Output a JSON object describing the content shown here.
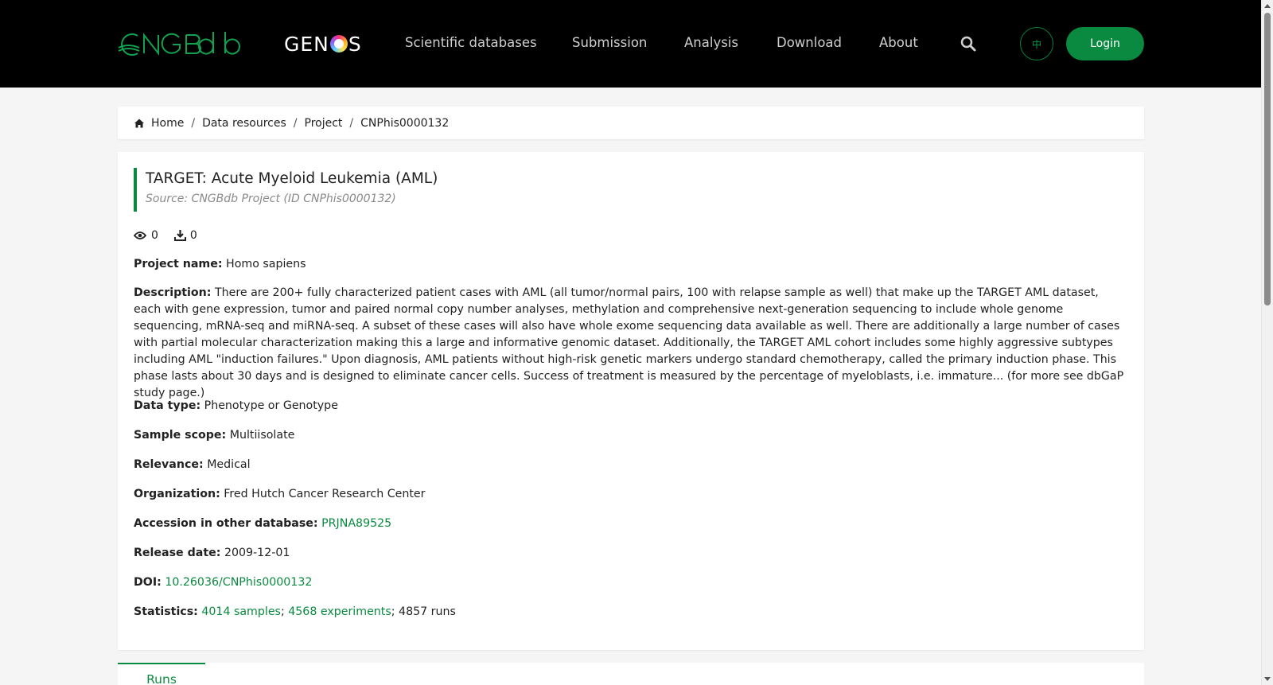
{
  "header": {
    "logo_cngb": "CNGBdb",
    "logo_genos_pre": "GEN",
    "logo_genos_post": "S",
    "nav": [
      "Scientific databases",
      "Submission",
      "Analysis",
      "Download",
      "About"
    ],
    "search_icon": "search-icon",
    "lang_label": "中",
    "login_label": "Login",
    "accent_color": "#0a8a40"
  },
  "breadcrumb": {
    "home_icon": "home-icon",
    "items": [
      "Home",
      "Data resources",
      "Project",
      "CNPhis0000132"
    ]
  },
  "project": {
    "title": "TARGET: Acute Myeloid Leukemia (AML)",
    "source": "Source: CNGBdb Project (ID CNPhis0000132)",
    "views": "0",
    "downloads": "0",
    "fields": {
      "project_name": {
        "label": "Project name:",
        "value": "Homo sapiens"
      },
      "description": {
        "label": "Description:",
        "value": "There are 200+ fully characterized patient cases with AML (all tumor/normal pairs, 100 with relapse sample as well) that make up the TARGET AML dataset, each with gene expression, tumor and paired normal copy number analyses, methylation and comprehensive next-generation sequencing to include whole genome sequencing, mRNA-seq and miRNA-seq. A subset of these cases will also have whole exome sequencing data available as well. There are additionally a large number of cases with partial molecular characterization making this a large and informative genomic dataset. Additionally, the TARGET AML cohort includes some highly aggressive subtypes including AML \"induction failures.\" Upon diagnosis, AML patients without high-risk genetic markers undergo standard chemotherapy, called the primary induction phase. This phase lasts about 30 days and is designed to eliminate cancer cells. Success of treatment is measured by the percentage of myeloblasts, i.e. immature... (for more see dbGaP study page.)"
      },
      "data_type": {
        "label": "Data type:",
        "value": "Phenotype or Genotype"
      },
      "sample_scope": {
        "label": "Sample scope:",
        "value": "Multiisolate"
      },
      "relevance": {
        "label": "Relevance:",
        "value": "Medical"
      },
      "organization": {
        "label": "Organization:",
        "value": "Fred Hutch Cancer Research Center"
      },
      "accession": {
        "label": "Accession in other database:",
        "value": "PRJNA89525"
      },
      "release_date": {
        "label": "Release date:",
        "value": "2009-12-01"
      },
      "doi": {
        "label": "DOI:",
        "value": "10.26036/CNPhis0000132"
      },
      "statistics": {
        "label": "Statistics:",
        "samples": "4014 samples",
        "sep1": "; ",
        "experiments": "4568 experiments",
        "sep2": "; ",
        "runs": "4857 runs"
      }
    }
  },
  "tabs": {
    "runs": "Runs"
  }
}
